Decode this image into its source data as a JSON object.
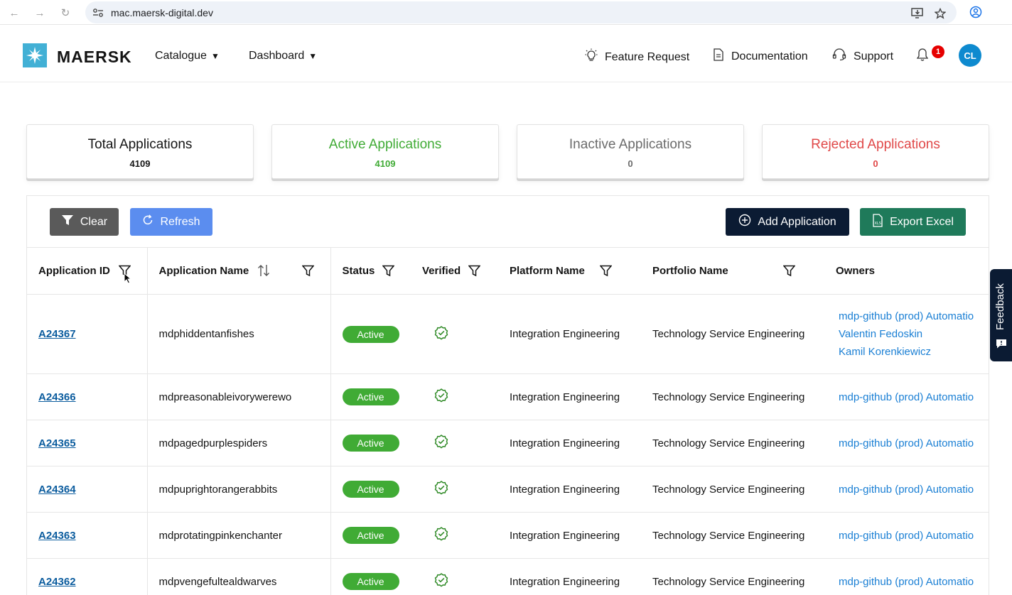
{
  "browser": {
    "url": "mac.maersk-digital.dev"
  },
  "header": {
    "logo_text": "MAERSK",
    "menu": [
      {
        "label": "Catalogue"
      },
      {
        "label": "Dashboard"
      }
    ],
    "links": {
      "feature_request": "Feature Request",
      "documentation": "Documentation",
      "support": "Support"
    },
    "notification_count": "1",
    "avatar_initials": "CL"
  },
  "stats": [
    {
      "title": "Total Applications",
      "value": "4109",
      "color": "#141414"
    },
    {
      "title": "Active Applications",
      "value": "4109",
      "color": "#40ab35"
    },
    {
      "title": "Inactive Applications",
      "value": "0",
      "color": "#6b6b6b"
    },
    {
      "title": "Rejected Applications",
      "value": "0",
      "color": "#e04848"
    }
  ],
  "toolbar": {
    "clear_label": "Clear",
    "refresh_label": "Refresh",
    "add_label": "Add Application",
    "export_label": "Export Excel"
  },
  "table": {
    "columns": {
      "app_id": "Application ID",
      "app_name": "Application Name",
      "status": "Status",
      "verified": "Verified",
      "platform": "Platform Name",
      "portfolio": "Portfolio Name",
      "owners": "Owners"
    },
    "rows": [
      {
        "id": "A24367",
        "name": "mdphiddentanfishes",
        "status": "Active",
        "platform": "Integration Engineering",
        "portfolio": "Technology Service Engineering",
        "owners": [
          "mdp-github (prod) Automatio",
          "Valentin Fedoskin",
          "Kamil Korenkiewicz"
        ]
      },
      {
        "id": "A24366",
        "name": "mdpreasonableivorywerewo",
        "status": "Active",
        "platform": "Integration Engineering",
        "portfolio": "Technology Service Engineering",
        "owners": [
          "mdp-github (prod) Automatio"
        ]
      },
      {
        "id": "A24365",
        "name": "mdpagedpurplespiders",
        "status": "Active",
        "platform": "Integration Engineering",
        "portfolio": "Technology Service Engineering",
        "owners": [
          "mdp-github (prod) Automatio"
        ]
      },
      {
        "id": "A24364",
        "name": "mdpuprightorangerabbits",
        "status": "Active",
        "platform": "Integration Engineering",
        "portfolio": "Technology Service Engineering",
        "owners": [
          "mdp-github (prod) Automatio"
        ]
      },
      {
        "id": "A24363",
        "name": "mdprotatingpinkenchanter",
        "status": "Active",
        "platform": "Integration Engineering",
        "portfolio": "Technology Service Engineering",
        "owners": [
          "mdp-github (prod) Automatio"
        ]
      },
      {
        "id": "A24362",
        "name": "mdpvengefultealdwarves",
        "status": "Active",
        "platform": "Integration Engineering",
        "portfolio": "Technology Service Engineering",
        "owners": [
          "mdp-github (prod) Automatio"
        ]
      }
    ]
  },
  "feedback_label": "Feedback"
}
